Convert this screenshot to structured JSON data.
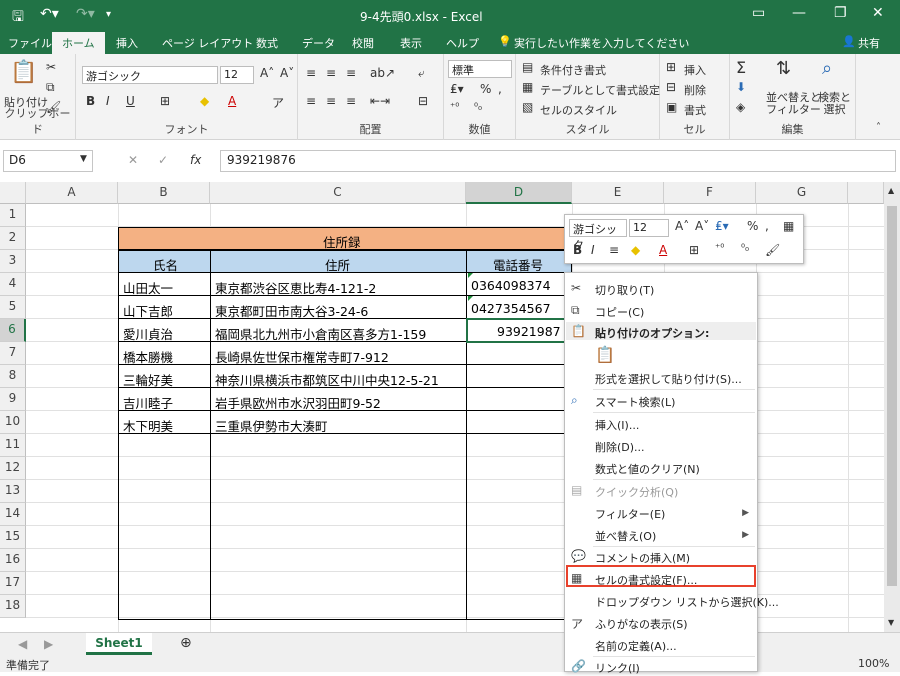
{
  "titlebar": {
    "title": "9-4先頭0.xlsx  -  Excel"
  },
  "tabs": [
    "ファイル",
    "ホーム",
    "挿入",
    "ページ レイアウト",
    "数式",
    "データ",
    "校閲",
    "表示",
    "ヘルプ"
  ],
  "tell_me": "実行したい作業を入力してください",
  "share": "共有",
  "ribbon": {
    "paste": "貼り付け",
    "font_name": "游ゴシック",
    "font_size": "12",
    "number_format": "標準",
    "cond_format": "条件付き書式",
    "table_format": "テーブルとして書式設定",
    "cell_style": "セルのスタイル",
    "insert": "挿入",
    "delete": "削除",
    "format": "書式",
    "sort_filter": "並べ替えと\nフィルター",
    "find_select": "検索と\n選択",
    "groups": {
      "clipboard": "クリップボード",
      "font": "フォント",
      "alignment": "配置",
      "number": "数値",
      "styles": "スタイル",
      "cells": "セル",
      "editing": "編集"
    }
  },
  "formula_bar": {
    "name_box": "D6",
    "formula": "939219876",
    "fx": "fx"
  },
  "columns": [
    "A",
    "B",
    "C",
    "D",
    "E",
    "F",
    "G"
  ],
  "rows": [
    "1",
    "2",
    "3",
    "4",
    "5",
    "6",
    "7",
    "8",
    "9",
    "10",
    "11",
    "12",
    "13",
    "14",
    "15",
    "16",
    "17",
    "18"
  ],
  "table": {
    "title": "住所録",
    "headers": [
      "氏名",
      "住所",
      "電話番号"
    ],
    "rows": [
      [
        "山田太一",
        "東京都渋谷区恵比寿4-121-2",
        "0364098374"
      ],
      [
        "山下吉郎",
        "東京都町田市南大谷3-24-6",
        "0427354567"
      ],
      [
        "愛川貞治",
        "福岡県北九州市小倉南区喜多方1-159",
        "93921987"
      ],
      [
        "橋本勝機",
        "長崎県佐世保市権常寺町7-912",
        ""
      ],
      [
        "三輪好美",
        "神奈川県横浜市都筑区中川中央12-5-21",
        ""
      ],
      [
        "吉川睦子",
        "岩手県欧州市水沢羽田町9-52",
        ""
      ],
      [
        "木下明美",
        "三重県伊勢市大湊町",
        ""
      ]
    ]
  },
  "mini_toolbar": {
    "font_name": "游ゴシック",
    "font_size": "12"
  },
  "context_menu": {
    "cut": "切り取り(T)",
    "copy": "コピー(C)",
    "paste_options": "貼り付けのオプション:",
    "paste_special": "形式を選択して貼り付け(S)...",
    "smart_lookup": "スマート検索(L)",
    "insert": "挿入(I)...",
    "delete": "削除(D)...",
    "clear": "数式と値のクリア(N)",
    "quick_analysis": "クイック分析(Q)",
    "filter": "フィルター(E)",
    "sort": "並べ替え(O)",
    "insert_comment": "コメントの挿入(M)",
    "format_cells": "セルの書式設定(F)...",
    "dropdown": "ドロップダウン リストから選択(K)...",
    "furigana": "ふりがなの表示(S)",
    "define_name": "名前の定義(A)...",
    "link": "リンク(I)"
  },
  "sheet_tab": "Sheet1",
  "status": {
    "ready": "準備完了",
    "zoom": "100%"
  },
  "colors": {
    "excel_green": "#217346",
    "title_fill": "#f4b183",
    "header_fill": "#bdd7ee",
    "highlight": "#e8412c"
  }
}
